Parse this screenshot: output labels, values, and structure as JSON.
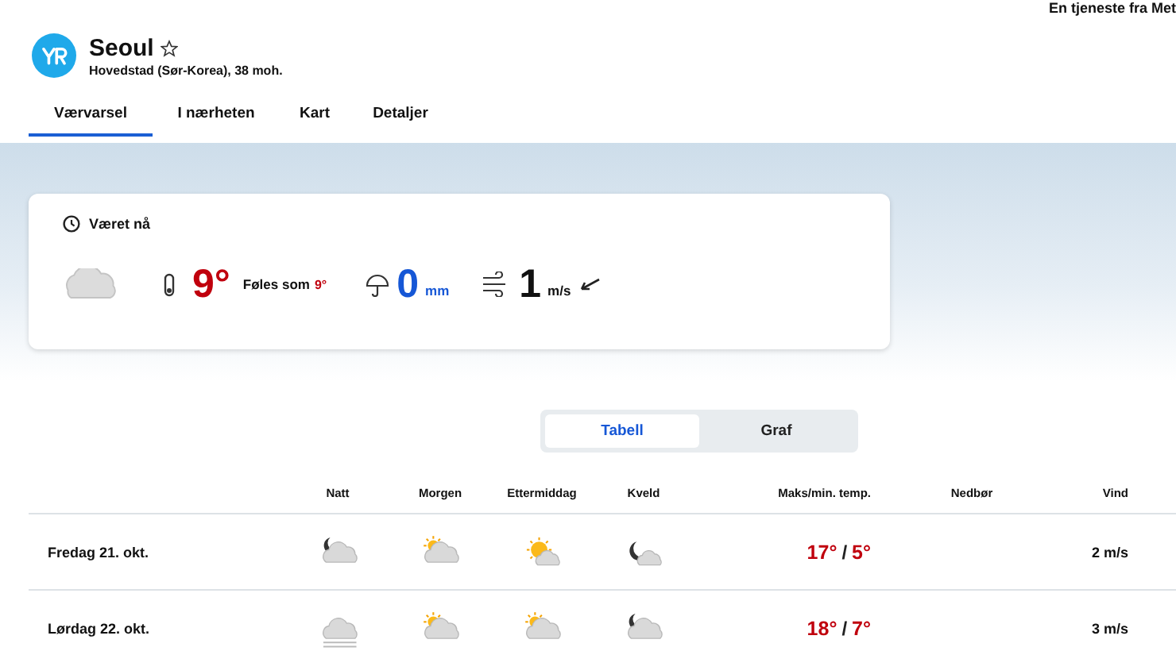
{
  "service_note": "En tjeneste fra Met",
  "location": {
    "name": "Seoul",
    "favorite": false,
    "subtitle": "Hovedstad (Sør-Korea), 38 moh."
  },
  "tabs": [
    {
      "label": "Værvarsel",
      "selected": true
    },
    {
      "label": "I nærheten",
      "selected": false
    },
    {
      "label": "Kart",
      "selected": false
    },
    {
      "label": "Detaljer",
      "selected": false
    }
  ],
  "now": {
    "title": "Været nå",
    "temperature": "9°",
    "feels_like_label": "Føles som",
    "feels_like": "9°",
    "precipitation": "0",
    "precipitation_unit": "mm",
    "wind": "1",
    "wind_unit": "m/s"
  },
  "view_toggle": [
    {
      "label": "Tabell",
      "selected": true
    },
    {
      "label": "Graf",
      "selected": false
    }
  ],
  "table": {
    "columns": [
      "Natt",
      "Morgen",
      "Ettermiddag",
      "Kveld",
      "Maks/min. temp.",
      "Nedbør",
      "Vind"
    ],
    "rows": [
      {
        "date": "Fredag 21. okt.",
        "icons": [
          {
            "kind": "moon-cloud"
          },
          {
            "kind": "sun-cloud"
          },
          {
            "kind": "sun-small-cloud"
          },
          {
            "kind": "moon-small-cloud"
          }
        ],
        "max": "17°",
        "separator": "/",
        "min": "5°",
        "wind": "2 m/s"
      },
      {
        "date": "Lørdag 22. okt.",
        "icons": [
          {
            "kind": "fog"
          },
          {
            "kind": "sun-cloud"
          },
          {
            "kind": "sun-cloud"
          },
          {
            "kind": "moon-cloud"
          }
        ],
        "max": "18°",
        "separator": "/",
        "min": "7°",
        "wind": "3 m/s"
      }
    ]
  }
}
